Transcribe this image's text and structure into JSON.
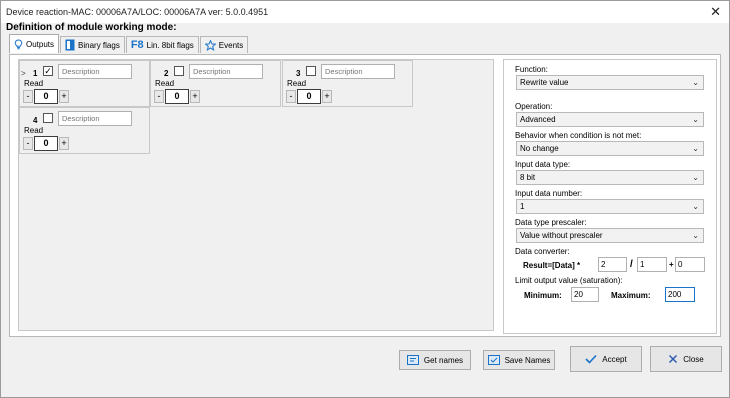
{
  "window": {
    "title": "Device reaction-MAC: 00006A7A/LOC: 00006A7A ver: 5.0.0.4951",
    "close_glyph": "✕"
  },
  "section_title": "Definition of module working mode:",
  "tabs": [
    {
      "label": "Outputs",
      "icon": "lightbulb-icon",
      "active": true
    },
    {
      "label": "Binary flags",
      "icon": "binary-flag-icon",
      "active": false
    },
    {
      "label": "Lin. 8bit flags",
      "icon": "f8-icon",
      "icon_text": "F8",
      "active": false
    },
    {
      "label": "Events",
      "icon": "star-icon",
      "active": false
    }
  ],
  "outputs": [
    {
      "number": "1",
      "checked": true,
      "description_placeholder": "Description",
      "read_label": "Read",
      "value": "0",
      "selected_arrow": ">"
    },
    {
      "number": "2",
      "checked": false,
      "description_placeholder": "Description",
      "read_label": "Read",
      "value": "0"
    },
    {
      "number": "3",
      "checked": false,
      "description_placeholder": "Description",
      "read_label": "Read",
      "value": "0"
    },
    {
      "number": "4",
      "checked": false,
      "description_placeholder": "Description",
      "read_label": "Read",
      "value": "0"
    }
  ],
  "spin": {
    "minus": "-",
    "plus": "+"
  },
  "settings": {
    "function_label": "Function:",
    "function_value": "Rewrite value",
    "operation_label": "Operation:",
    "operation_value": "Advanced",
    "behavior_label": "Behavior when condition is not met:",
    "behavior_value": "No change",
    "input_type_label": "Input data type:",
    "input_type_value": "8 bit",
    "input_number_label": "Input data number:",
    "input_number_value": "1",
    "prescaler_label": "Data type prescaler:",
    "prescaler_value": "Value without prescaler",
    "converter_label": "Data converter:",
    "result_label": "Result=[Data] *",
    "multiplier": "2",
    "divide_sign": "/",
    "divisor": "1",
    "plus_sign": "+",
    "offset": "0",
    "limit_label": "Limit output value (saturation):",
    "min_label": "Minimum:",
    "min_value": "20",
    "max_label": "Maximum:",
    "max_value": "200"
  },
  "buttons": {
    "get_names": "Get names",
    "save_names": "Save Names",
    "accept": "Accept",
    "close": "Close"
  },
  "colors": {
    "accent_blue": "#1a73c9",
    "close_red": "#2f5fb5"
  }
}
